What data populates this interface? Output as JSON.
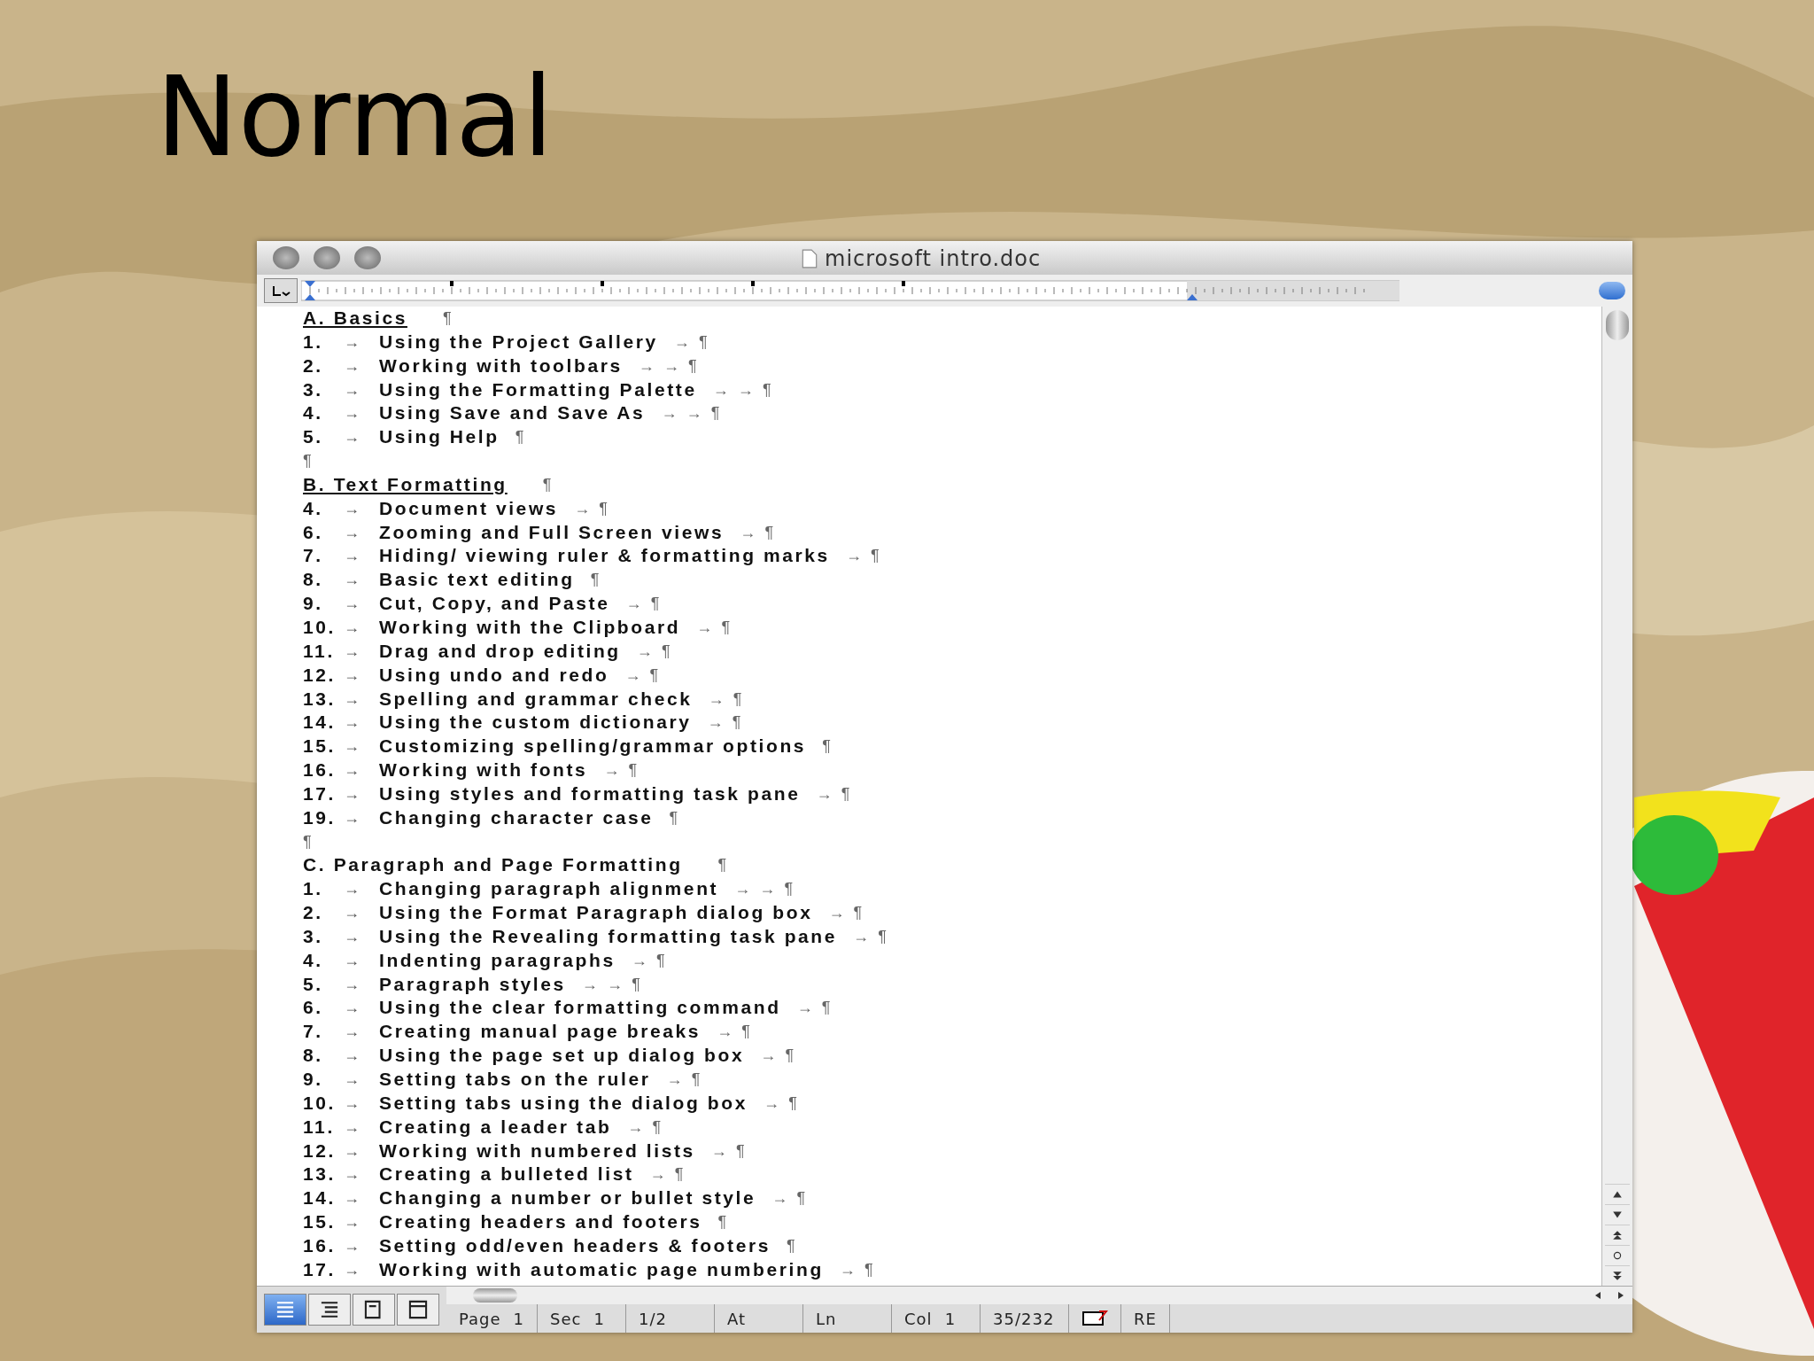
{
  "slide": {
    "title": "Normal"
  },
  "window": {
    "title": "microsoft intro.doc"
  },
  "document": {
    "paragraphs": [
      {
        "kind": "heading",
        "text": "A. Basics",
        "underlined": true,
        "end": "¶"
      },
      {
        "kind": "item",
        "number": "1.",
        "tab": "→",
        "text": "Using the Project Gallery",
        "end": "→ ¶"
      },
      {
        "kind": "item",
        "number": "2.",
        "tab": "→",
        "text": "Working with toolbars",
        "end": "→ → ¶"
      },
      {
        "kind": "item",
        "number": "3.",
        "tab": "→",
        "text": "Using the Formatting Palette",
        "end": "→ → ¶"
      },
      {
        "kind": "item",
        "number": "4.",
        "tab": "→",
        "text": "Using Save and Save As",
        "end": "→ → ¶"
      },
      {
        "kind": "item",
        "number": "5.",
        "tab": "→",
        "text": "Using Help",
        "end": "¶"
      },
      {
        "kind": "blank",
        "end": "¶"
      },
      {
        "kind": "heading",
        "text": "B. Text Formatting",
        "underlined": true,
        "end": "¶"
      },
      {
        "kind": "item",
        "number": "4.",
        "tab": "→",
        "text": "Document views",
        "end": "→ ¶"
      },
      {
        "kind": "item",
        "number": "6.",
        "tab": "→",
        "text": "Zooming and Full Screen views",
        "end": "→ ¶"
      },
      {
        "kind": "item",
        "number": "7.",
        "tab": "→",
        "text": "Hiding/ viewing ruler & formatting marks",
        "end": "→ ¶"
      },
      {
        "kind": "item",
        "number": "8.",
        "tab": "→",
        "text": "Basic text editing",
        "end": "¶"
      },
      {
        "kind": "item",
        "number": "9.",
        "tab": "→",
        "text": "Cut, Copy, and Paste",
        "end": "→ ¶"
      },
      {
        "kind": "item",
        "number": "10.",
        "tab": "→",
        "text": "Working with the Clipboard",
        "end": "→ ¶"
      },
      {
        "kind": "item",
        "number": "11.",
        "tab": "→",
        "text": "Drag and drop editing",
        "end": "→ ¶"
      },
      {
        "kind": "item",
        "number": "12.",
        "tab": "→",
        "text": "Using undo and redo",
        "end": "→ ¶"
      },
      {
        "kind": "item",
        "number": "13.",
        "tab": "→",
        "text": "Spelling and grammar check",
        "end": "→ ¶"
      },
      {
        "kind": "item",
        "number": "14.",
        "tab": "→",
        "text": "Using the custom dictionary",
        "end": "→ ¶"
      },
      {
        "kind": "item",
        "number": "15.",
        "tab": "→",
        "text": "Customizing spelling/grammar options",
        "end": "¶"
      },
      {
        "kind": "item",
        "number": "16.",
        "tab": "→",
        "text": "Working with fonts",
        "end": "→ ¶"
      },
      {
        "kind": "item",
        "number": "17.",
        "tab": "→",
        "text": "Using styles and formatting task pane",
        "end": "→ ¶"
      },
      {
        "kind": "item",
        "number": "19.",
        "tab": "→",
        "text": "Changing character case",
        "end": "¶"
      },
      {
        "kind": "blank",
        "end": "¶"
      },
      {
        "kind": "heading",
        "text": "C. Paragraph and Page Formatting",
        "underlined": false,
        "end": "¶"
      },
      {
        "kind": "item",
        "number": "1.",
        "tab": "→",
        "text": "Changing paragraph alignment",
        "end": "→ → ¶"
      },
      {
        "kind": "item",
        "number": "2.",
        "tab": "→",
        "text": "Using the Format Paragraph dialog box",
        "end": "→ ¶"
      },
      {
        "kind": "item",
        "number": "3.",
        "tab": "→",
        "text": "Using the Revealing formatting task pane",
        "end": "→ ¶"
      },
      {
        "kind": "item",
        "number": "4.",
        "tab": "→",
        "text": "Indenting paragraphs",
        "end": "→ ¶"
      },
      {
        "kind": "item",
        "number": "5.",
        "tab": "→",
        "text": "Paragraph styles",
        "end": "→ → ¶"
      },
      {
        "kind": "item",
        "number": "6.",
        "tab": "→",
        "text": "Using the clear formatting command",
        "end": "→ ¶"
      },
      {
        "kind": "item",
        "number": "7.",
        "tab": "→",
        "text": "Creating manual page breaks",
        "end": "→ ¶"
      },
      {
        "kind": "item",
        "number": "8.",
        "tab": "→",
        "text": "Using the page set up dialog box",
        "end": "→ ¶"
      },
      {
        "kind": "item",
        "number": "9.",
        "tab": "→",
        "text": "Setting tabs on the ruler",
        "end": "→ ¶"
      },
      {
        "kind": "item",
        "number": "10.",
        "tab": "→",
        "text": "Setting tabs using the dialog box",
        "end": "→ ¶"
      },
      {
        "kind": "item",
        "number": "11.",
        "tab": "→",
        "text": "Creating a leader tab",
        "end": "→ ¶"
      },
      {
        "kind": "item",
        "number": "12.",
        "tab": "→",
        "text": "Working with numbered lists",
        "end": "→ ¶"
      },
      {
        "kind": "item",
        "number": "13.",
        "tab": "→",
        "text": "Creating a bulleted list",
        "end": "→ ¶"
      },
      {
        "kind": "item",
        "number": "14.",
        "tab": "→",
        "text": "Changing a number or bullet style",
        "end": "→ ¶"
      },
      {
        "kind": "item",
        "number": "15.",
        "tab": "→",
        "text": "Creating headers and footers",
        "end": "¶"
      },
      {
        "kind": "item",
        "number": "16.",
        "tab": "→",
        "text": "Setting odd/even headers & footers",
        "end": "¶"
      },
      {
        "kind": "item",
        "number": "17.",
        "tab": "→",
        "text": "Working with automatic page numbering",
        "end": "→ ¶"
      }
    ]
  },
  "view_buttons": [
    {
      "kind": "normal",
      "selected": true
    },
    {
      "kind": "outline",
      "selected": false
    },
    {
      "kind": "layout",
      "selected": false
    },
    {
      "kind": "notebook",
      "selected": false
    }
  ],
  "status_bar": [
    {
      "label": "Page",
      "value": "1"
    },
    {
      "label": "Sec",
      "value": "1"
    },
    {
      "value": "1/2"
    },
    {
      "label": "At"
    },
    {
      "label": "Ln"
    },
    {
      "label": "Col",
      "value": "1"
    },
    {
      "value": "35/232"
    }
  ],
  "status_mode": "RE"
}
